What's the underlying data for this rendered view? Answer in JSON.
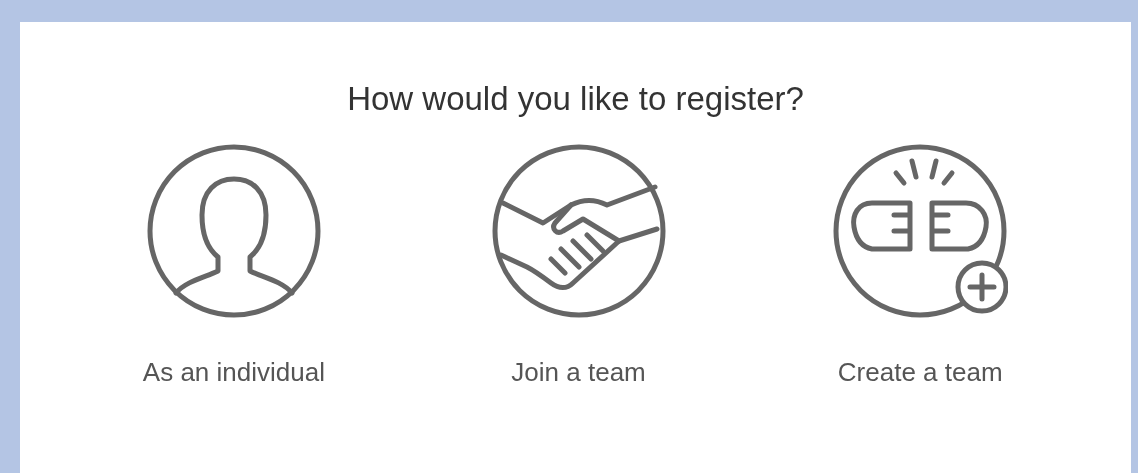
{
  "title": "How would you like to register?",
  "options": [
    {
      "kind": "individual",
      "label": "As an individual"
    },
    {
      "kind": "join",
      "label": "Join a team"
    },
    {
      "kind": "create",
      "label": "Create a team"
    }
  ]
}
